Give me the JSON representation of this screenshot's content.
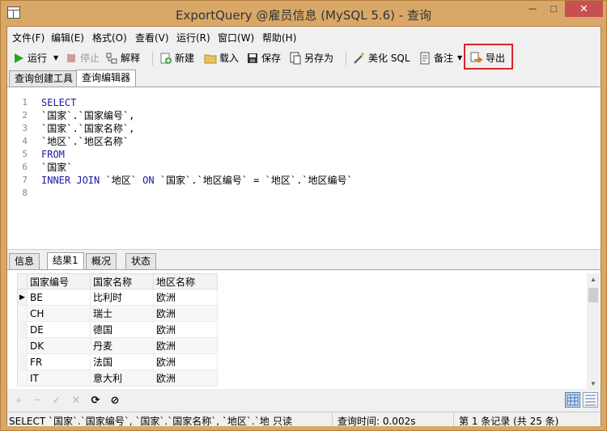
{
  "window": {
    "title": "ExportQuery @雇员信息 (MySQL 5.6) - 查询",
    "minimize": "─",
    "maximize": "□",
    "close": "✕"
  },
  "menu": [
    {
      "label": "文件(F)"
    },
    {
      "label": "编辑(E)"
    },
    {
      "label": "格式(O)"
    },
    {
      "label": "查看(V)"
    },
    {
      "label": "运行(R)"
    },
    {
      "label": "窗口(W)"
    },
    {
      "label": "帮助(H)"
    }
  ],
  "toolbar": {
    "run": "运行",
    "stop": "停止",
    "explain": "解释",
    "new": "新建",
    "load": "载入",
    "save": "保存",
    "save_as": "另存为",
    "beautify": "美化 SQL",
    "notes": "备注",
    "export": "导出"
  },
  "top_tabs": [
    {
      "label": "查询创建工具"
    },
    {
      "label": "查询编辑器"
    }
  ],
  "editor": {
    "lines": [
      {
        "num": "1",
        "text": "SELECT",
        "keyword": true
      },
      {
        "num": "2",
        "text": "`国家`.`国家编号`,",
        "keyword": false
      },
      {
        "num": "3",
        "text": "`国家`.`国家名称`,",
        "keyword": false
      },
      {
        "num": "4",
        "text": "`地区`.`地区名称`",
        "keyword": false
      },
      {
        "num": "5",
        "text": "FROM",
        "keyword": true
      },
      {
        "num": "6",
        "text": "`国家`",
        "keyword": false
      },
      {
        "num": "7",
        "kw1": "INNER JOIN",
        "mid1": " `地区` ",
        "kw2": "ON",
        "rest": " `国家`.`地区编号` = `地区`.`地区编号`"
      },
      {
        "num": "8",
        "text": "",
        "keyword": false
      }
    ]
  },
  "result_tabs": [
    {
      "label": "信息"
    },
    {
      "label": "结果1"
    },
    {
      "label": "概况"
    },
    {
      "label": "状态"
    }
  ],
  "grid": {
    "columns": [
      "国家编号",
      "国家名称",
      "地区名称"
    ],
    "rows": [
      [
        "BE",
        "比利时",
        "欧洲"
      ],
      [
        "CH",
        "瑞士",
        "欧洲"
      ],
      [
        "DE",
        "德国",
        "欧洲"
      ],
      [
        "DK",
        "丹麦",
        "欧洲"
      ],
      [
        "FR",
        "法国",
        "欧洲"
      ],
      [
        "IT",
        "意大利",
        "欧洲"
      ]
    ],
    "current_row_marker": "▶"
  },
  "gridbar": {
    "add": "+",
    "remove": "−",
    "apply": "✓",
    "discard": "✕",
    "refresh": "⟳",
    "stop": "⊘"
  },
  "status": {
    "sql": "SELECT `国家`.`国家编号`, `国家`.`国家名称`, `地区`.`地区名称",
    "mode": "只读",
    "query_time": "查询时间: 0.002s",
    "record": "第 1 条记录 (共 25 条)"
  },
  "colors": {
    "frame": "#d9a868",
    "keyword": "#1a1aa6",
    "highlight_box": "#d7262b",
    "close_button": "#c75050"
  }
}
